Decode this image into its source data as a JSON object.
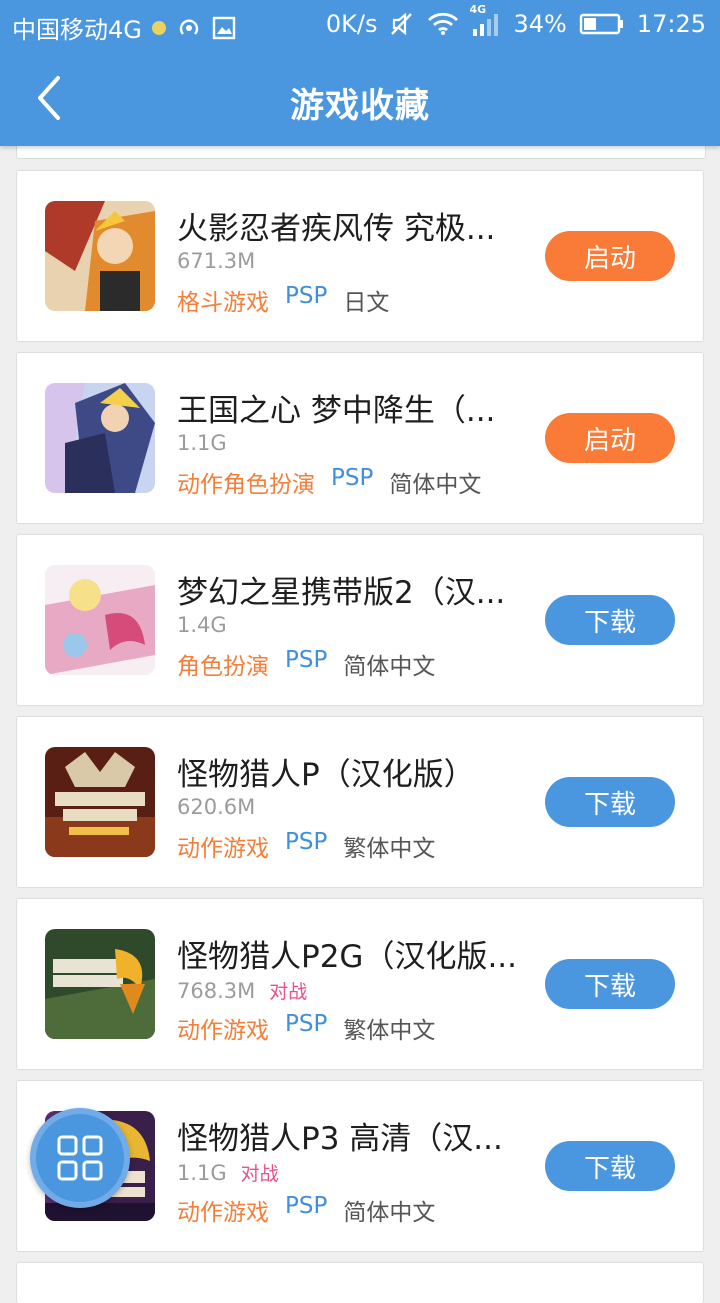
{
  "status_bar": {
    "carrier": "中国移动4G",
    "speed": "0K/s",
    "network": "4G",
    "battery": "34%",
    "time": "17:25",
    "icons": [
      "notification-dot-icon",
      "hotspot-icon",
      "image-icon",
      "mute-icon",
      "wifi-icon",
      "signal-icon",
      "battery-icon"
    ]
  },
  "header": {
    "title": "游戏收藏",
    "back_icon": "back-arrow-icon"
  },
  "games": [
    {
      "title": "火影忍者疾风传 究极...",
      "size": "671.3M",
      "badge": "",
      "genre": "格斗游戏",
      "platform": "PSP",
      "language": "日文",
      "action": "启动",
      "action_type": "launch"
    },
    {
      "title": "王国之心 梦中降生（...",
      "size": "1.1G",
      "badge": "",
      "genre": "动作角色扮演",
      "platform": "PSP",
      "language": "简体中文",
      "action": "启动",
      "action_type": "launch"
    },
    {
      "title": "梦幻之星携带版2（汉...",
      "size": "1.4G",
      "badge": "",
      "genre": "角色扮演",
      "platform": "PSP",
      "language": "简体中文",
      "action": "下载",
      "action_type": "download"
    },
    {
      "title": "怪物猎人P（汉化版）",
      "size": "620.6M",
      "badge": "",
      "genre": "动作游戏",
      "platform": "PSP",
      "language": "繁体中文",
      "action": "下载",
      "action_type": "download"
    },
    {
      "title": "怪物猎人P2G（汉化版...",
      "size": "768.3M",
      "badge": "对战",
      "genre": "动作游戏",
      "platform": "PSP",
      "language": "繁体中文",
      "action": "下载",
      "action_type": "download"
    },
    {
      "title": "怪物猎人P3 高清（汉...",
      "size": "1.1G",
      "badge": "对战",
      "genre": "动作游戏",
      "platform": "PSP",
      "language": "简体中文",
      "action": "下载",
      "action_type": "download"
    }
  ],
  "fab": {
    "icon": "grid-menu-icon"
  },
  "colors": {
    "primary": "#4a97e0",
    "launch": "#fa7a37",
    "genre": "#f47f3a",
    "platform": "#3f8fdc",
    "badge": "#e8508e"
  }
}
